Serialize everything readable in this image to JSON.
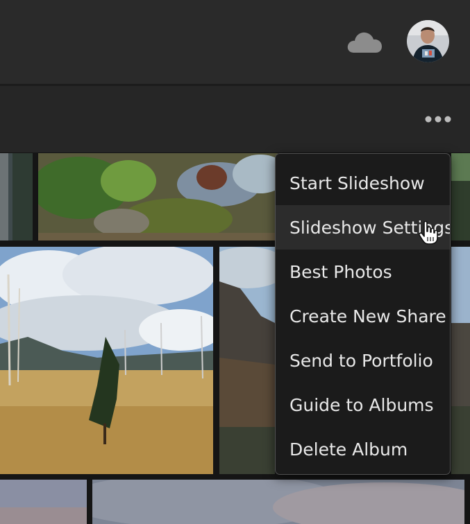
{
  "menu": {
    "items": [
      {
        "label": "Start Slideshow"
      },
      {
        "label": "Slideshow Settings"
      },
      {
        "label": "Best Photos"
      },
      {
        "label": "Create New Share"
      },
      {
        "label": "Send to Portfolio"
      },
      {
        "label": "Guide to Albums"
      },
      {
        "label": "Delete Album"
      }
    ],
    "hovered": "Slideshow Settings"
  },
  "header": {
    "icons": [
      "cloud-icon",
      "user-avatar"
    ],
    "more_icon": "more-options-icon"
  },
  "colors": {
    "topbar": "#2a2a2a",
    "subbar": "#262626",
    "menu_bg": "#1b1b1b",
    "menu_hover": "#2c2c2c",
    "menu_text": "#e9e9e9"
  }
}
